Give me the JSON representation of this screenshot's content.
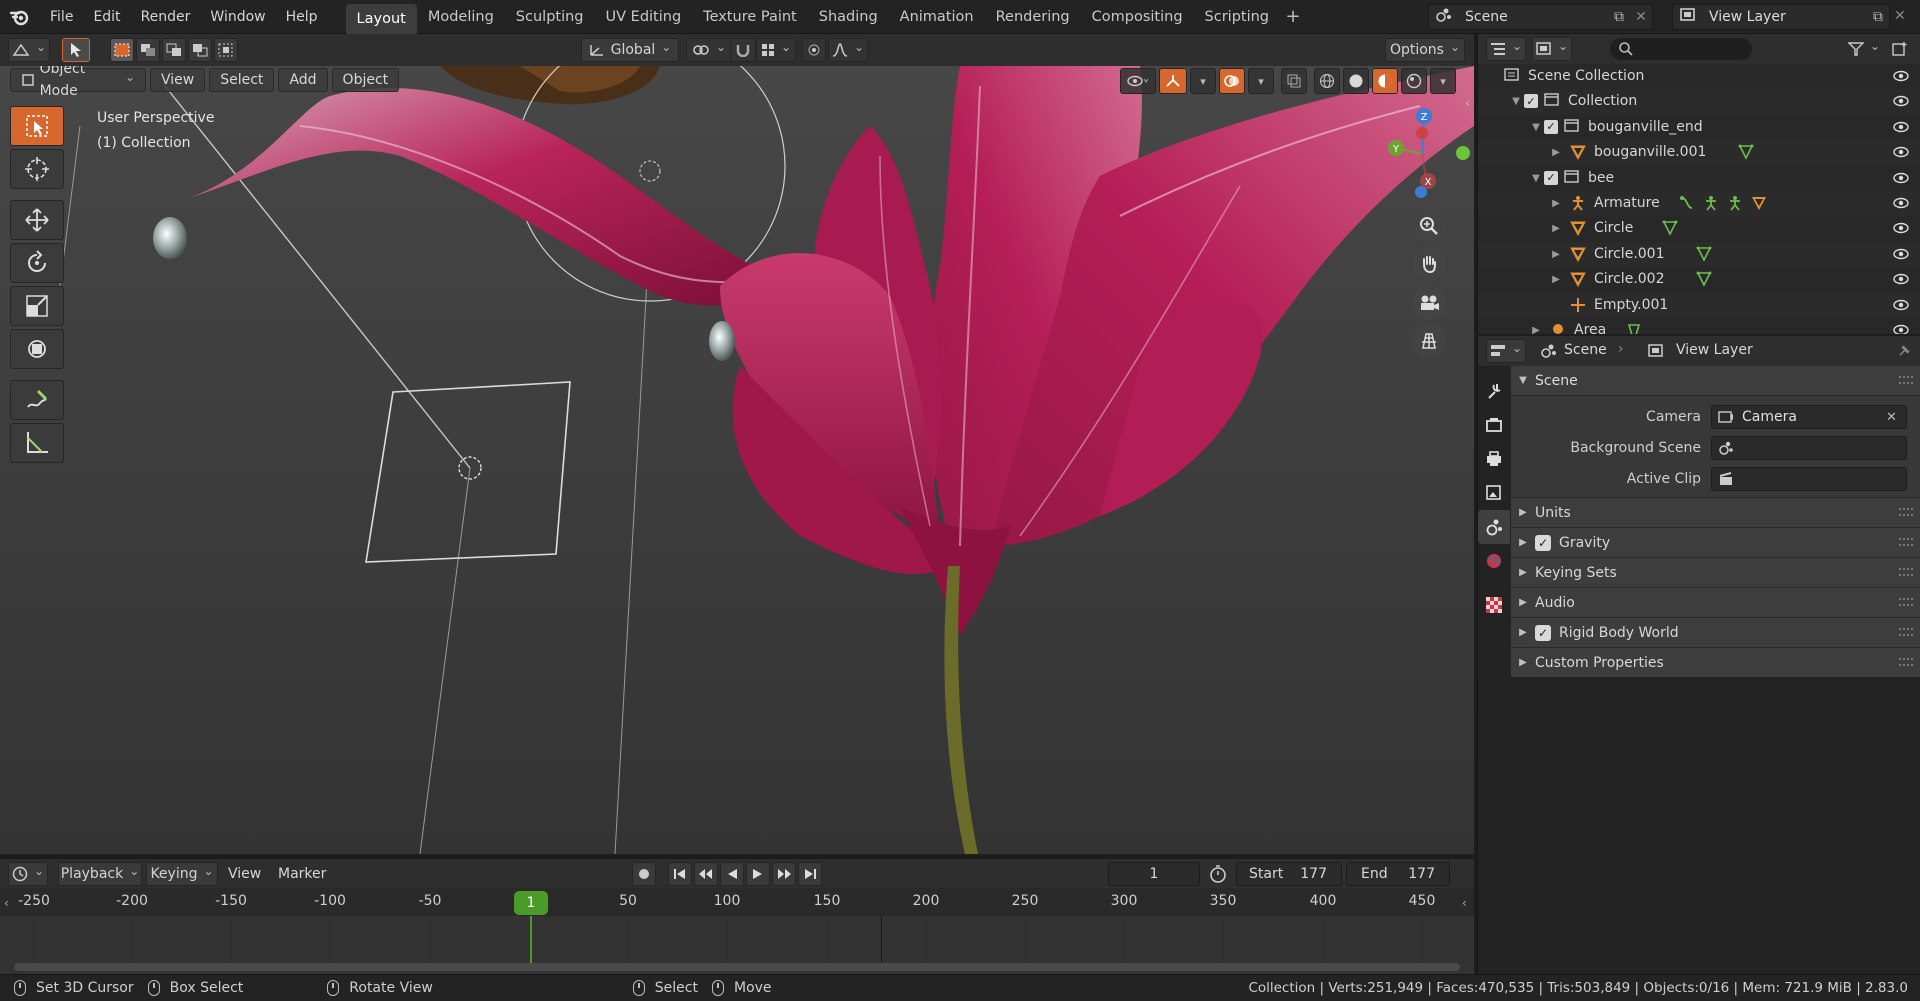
{
  "menu": {
    "items": [
      "File",
      "Edit",
      "Render",
      "Window",
      "Help"
    ]
  },
  "workspaces": {
    "tabs": [
      "Layout",
      "Modeling",
      "Sculpting",
      "UV Editing",
      "Texture Paint",
      "Shading",
      "Animation",
      "Rendering",
      "Compositing",
      "Scripting"
    ],
    "active": "Layout",
    "add_label": "+"
  },
  "topright": {
    "scene": "Scene",
    "view_layer": "View Layer"
  },
  "tool_header": {
    "orientation": "Global",
    "options": "Options"
  },
  "viewport": {
    "mode": "Object Mode",
    "menus": [
      "View",
      "Select",
      "Add",
      "Object"
    ],
    "info_line1": "User Perspective",
    "info_line2": "(1) Collection"
  },
  "outliner": {
    "search_placeholder": "",
    "rows": [
      {
        "label": "Scene Collection",
        "icon": "scene-collection-icon",
        "indent": 0,
        "checkbox": false,
        "expander": "none"
      },
      {
        "label": "Collection",
        "icon": "collection-icon",
        "indent": 1,
        "checkbox": true,
        "expander": "open"
      },
      {
        "label": "bouganville_end",
        "icon": "collection-icon",
        "indent": 2,
        "checkbox": true,
        "expander": "open"
      },
      {
        "label": "bouganville.001",
        "icon": "mesh-icon",
        "indent": 3,
        "checkbox": false,
        "expander": "closed"
      },
      {
        "label": "bee",
        "icon": "collection-icon",
        "indent": 2,
        "checkbox": true,
        "expander": "open"
      },
      {
        "label": "Armature",
        "icon": "armature-icon",
        "indent": 3,
        "checkbox": false,
        "expander": "closed"
      },
      {
        "label": "Circle",
        "icon": "mesh-icon",
        "indent": 3,
        "checkbox": false,
        "expander": "closed"
      },
      {
        "label": "Circle.001",
        "icon": "mesh-icon",
        "indent": 3,
        "checkbox": false,
        "expander": "closed"
      },
      {
        "label": "Circle.002",
        "icon": "mesh-icon",
        "indent": 3,
        "checkbox": false,
        "expander": "closed"
      },
      {
        "label": "Empty.001",
        "icon": "empty-icon",
        "indent": 3,
        "checkbox": false,
        "expander": "none"
      },
      {
        "label": "Area",
        "icon": "light-icon",
        "indent": 2,
        "checkbox": false,
        "expander": "closed"
      }
    ]
  },
  "properties": {
    "breadcrumb_scene": "Scene",
    "breadcrumb_layer": "View Layer",
    "panel_title": "Scene",
    "camera_label": "Camera",
    "camera_value": "Camera",
    "background_label": "Background Scene",
    "background_value": "",
    "clip_label": "Active Clip",
    "clip_value": "",
    "subpanels": [
      {
        "label": "Units",
        "checkbox": false
      },
      {
        "label": "Gravity",
        "checkbox": true
      },
      {
        "label": "Keying Sets",
        "checkbox": false
      },
      {
        "label": "Audio",
        "checkbox": false
      },
      {
        "label": "Rigid Body World",
        "checkbox": true
      },
      {
        "label": "Custom Properties",
        "checkbox": false
      }
    ]
  },
  "timeline": {
    "menus": [
      "Playback",
      "Keying",
      "View",
      "Marker"
    ],
    "current_frame": "1",
    "start_label": "Start",
    "start": "177",
    "end_label": "End",
    "end": "177",
    "ticks": [
      "-250",
      "-200",
      "-150",
      "-100",
      "-50",
      "1",
      "50",
      "100",
      "150",
      "200",
      "250",
      "300",
      "350",
      "400",
      "450"
    ]
  },
  "status": {
    "hint1": "Set 3D Cursor",
    "hint2": "Box Select",
    "hint3": "Rotate View",
    "hint4": "Select",
    "hint5": "Move",
    "stats": "Collection | Verts:251,949 | Faces:470,535 | Tris:503,849 | Objects:0/16 | Mem: 721.9 MiB | 2.83.0"
  },
  "colors": {
    "accent": "#d7672d",
    "playhead": "#4c9a2a",
    "petal": "#b8245a"
  }
}
